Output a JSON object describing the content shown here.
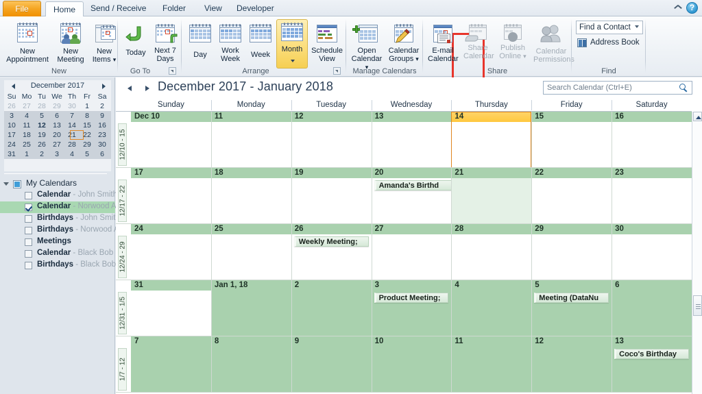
{
  "window": {
    "tabs": [
      {
        "label": "File",
        "id": "file"
      },
      {
        "label": "Home",
        "id": "home"
      },
      {
        "label": "Send / Receive",
        "id": "send-receive"
      },
      {
        "label": "Folder",
        "id": "folder"
      },
      {
        "label": "View",
        "id": "view"
      },
      {
        "label": "Developer",
        "id": "developer"
      }
    ],
    "active_tab": "Home",
    "help_label": "?",
    "minimize_ribbon_icon": "chevron-up-icon"
  },
  "ribbon": {
    "groups": [
      {
        "name": "New",
        "label": "New",
        "buttons": [
          {
            "label": "New\nAppointment",
            "id": "new-appointment",
            "icon": "calendar-icon",
            "enabled": true
          },
          {
            "label": "New\nMeeting",
            "id": "new-meeting",
            "icon": "calendar-people-icon",
            "enabled": true
          },
          {
            "label": "New\nItems",
            "id": "new-items",
            "icon": "calendar-stack-icon",
            "enabled": true,
            "has_caret": true
          }
        ]
      },
      {
        "name": "Go To",
        "label": "Go To",
        "has_dialog_launcher": true,
        "buttons": [
          {
            "label": "Today",
            "id": "today",
            "icon": "arrow-back-icon",
            "enabled": true
          },
          {
            "label": "Next 7\nDays",
            "id": "next-7-days",
            "icon": "calendar-arrow-icon",
            "enabled": true
          }
        ]
      },
      {
        "name": "Arrange",
        "label": "Arrange",
        "has_dialog_launcher": true,
        "buttons": [
          {
            "label": "Day",
            "id": "day-view",
            "icon": "calendar-day-icon",
            "enabled": true
          },
          {
            "label": "Work\nWeek",
            "id": "work-week-view",
            "icon": "calendar-workweek-icon",
            "enabled": true
          },
          {
            "label": "Week",
            "id": "week-view",
            "icon": "calendar-week-icon",
            "enabled": true
          },
          {
            "label": "Month",
            "id": "month-view",
            "icon": "calendar-month-icon",
            "enabled": true,
            "selected": true,
            "has_caret": true,
            "highlighted": true
          },
          {
            "label": "Schedule\nView",
            "id": "schedule-view",
            "icon": "schedule-icon",
            "enabled": true
          }
        ]
      },
      {
        "name": "Manage Calendars",
        "label": "Manage Calendars",
        "buttons": [
          {
            "label": "Open\nCalendar",
            "id": "open-calendar",
            "icon": "calendar-plus-icon",
            "enabled": true,
            "has_caret": true
          },
          {
            "label": "Calendar\nGroups",
            "id": "calendar-groups",
            "icon": "calendar-pencil-icon",
            "enabled": true,
            "has_caret": true
          }
        ]
      },
      {
        "name": "Share",
        "label": "Share",
        "buttons": [
          {
            "label": "E-mail\nCalendar",
            "id": "email-calendar",
            "icon": "calendar-mail-icon",
            "enabled": true
          },
          {
            "label": "Share\nCalendar",
            "id": "share-calendar",
            "icon": "calendar-hand-icon",
            "enabled": false
          },
          {
            "label": "Publish\nOnline",
            "id": "publish-online",
            "icon": "calendar-globe-icon",
            "enabled": false,
            "has_caret": true
          },
          {
            "label": "Calendar\nPermissions",
            "id": "calendar-permissions",
            "icon": "people-icon",
            "enabled": false
          }
        ]
      },
      {
        "name": "Find",
        "label": "Find",
        "find_a_contact": "Find a Contact",
        "address_book": "Address Book"
      }
    ]
  },
  "navpane": {
    "minicalendar": {
      "title": "December 2017",
      "prev_icon": "left-arrow-icon",
      "next_icon": "right-arrow-icon",
      "dow": [
        "Su",
        "Mo",
        "Tu",
        "We",
        "Th",
        "Fr",
        "Sa"
      ],
      "weeks": [
        [
          {
            "d": "26",
            "dim": true
          },
          {
            "d": "27",
            "dim": true
          },
          {
            "d": "28",
            "dim": true
          },
          {
            "d": "29",
            "dim": true
          },
          {
            "d": "30",
            "dim": true
          },
          {
            "d": "1"
          },
          {
            "d": "2"
          }
        ],
        [
          {
            "d": "3"
          },
          {
            "d": "4"
          },
          {
            "d": "5"
          },
          {
            "d": "6"
          },
          {
            "d": "7"
          },
          {
            "d": "8"
          },
          {
            "d": "9"
          }
        ],
        [
          {
            "d": "10"
          },
          {
            "d": "11"
          },
          {
            "d": "12",
            "bold": true
          },
          {
            "d": "13"
          },
          {
            "d": "14",
            "today": true
          },
          {
            "d": "15"
          },
          {
            "d": "16"
          }
        ],
        [
          {
            "d": "17"
          },
          {
            "d": "18"
          },
          {
            "d": "19"
          },
          {
            "d": "20"
          },
          {
            "d": "21"
          },
          {
            "d": "22"
          },
          {
            "d": "23"
          }
        ],
        [
          {
            "d": "24"
          },
          {
            "d": "25"
          },
          {
            "d": "26"
          },
          {
            "d": "27"
          },
          {
            "d": "28"
          },
          {
            "d": "29"
          },
          {
            "d": "30"
          }
        ],
        [
          {
            "d": "31"
          },
          {
            "d": "1"
          },
          {
            "d": "2"
          },
          {
            "d": "3"
          },
          {
            "d": "4"
          },
          {
            "d": "5"
          },
          {
            "d": "6"
          }
        ]
      ],
      "selected_range_rows": [
        2,
        3,
        4,
        5
      ],
      "today": "14"
    },
    "my_calendars_label": "My Calendars",
    "calendars": [
      {
        "name": "Calendar",
        "owner": " - John Smith",
        "checked": false
      },
      {
        "name": "Calendar",
        "owner": " - Norwood A",
        "checked": true
      },
      {
        "name": "Birthdays",
        "owner": " - John Smith",
        "checked": false
      },
      {
        "name": "Birthdays",
        "owner": " - Norwood A",
        "checked": false
      },
      {
        "name": "Meetings",
        "owner": "",
        "checked": false
      },
      {
        "name": "Calendar",
        "owner": " - Black Bob",
        "checked": false
      },
      {
        "name": "Birthdays",
        "owner": " - Black Bob",
        "checked": false
      }
    ]
  },
  "calendar": {
    "title": "December 2017 - January 2018",
    "prev_icon": "left-arrow-icon",
    "next_icon": "right-arrow-icon",
    "search_placeholder": "Search Calendar (Ctrl+E)",
    "search_icon": "search-icon",
    "day_headers": [
      "Sunday",
      "Monday",
      "Tuesday",
      "Wednesday",
      "Thursday",
      "Friday",
      "Saturday"
    ],
    "weeks": [
      {
        "label": "12/10 - 15",
        "days": [
          {
            "num": "Dec 10"
          },
          {
            "num": "11"
          },
          {
            "num": "12"
          },
          {
            "num": "13"
          },
          {
            "num": "14",
            "today": true
          },
          {
            "num": "15"
          },
          {
            "num": "16"
          }
        ]
      },
      {
        "label": "12/17 - 22",
        "days": [
          {
            "num": "17"
          },
          {
            "num": "18"
          },
          {
            "num": "19"
          },
          {
            "num": "20",
            "appointments": [
              {
                "title": "Amanda's Birthd",
                "span": 2
              }
            ]
          },
          {
            "num": "21",
            "selected": true
          },
          {
            "num": "22"
          },
          {
            "num": "23"
          }
        ]
      },
      {
        "label": "12/24 - 29",
        "days": [
          {
            "num": "24"
          },
          {
            "num": "25"
          },
          {
            "num": "26",
            "appointments": [
              {
                "title": "Weekly Meeting;",
                "span": 1
              }
            ]
          },
          {
            "num": "27"
          },
          {
            "num": "28"
          },
          {
            "num": "29"
          },
          {
            "num": "30"
          }
        ]
      },
      {
        "label": "12/31 - 1/5",
        "days": [
          {
            "num": "31"
          },
          {
            "num": "Jan 1, 18",
            "offmonth": true
          },
          {
            "num": "2",
            "offmonth": true
          },
          {
            "num": "3",
            "offmonth": true,
            "appointments": [
              {
                "title": "Product Meeting;",
                "span": 1
              }
            ]
          },
          {
            "num": "4",
            "offmonth": true
          },
          {
            "num": "5",
            "offmonth": true,
            "appointments": [
              {
                "title": "Meeting (DataNu",
                "span": 1
              }
            ]
          },
          {
            "num": "6",
            "offmonth": true
          }
        ]
      },
      {
        "label": "1/7 - 12",
        "days": [
          {
            "num": "7",
            "offmonth": true
          },
          {
            "num": "8",
            "offmonth": true
          },
          {
            "num": "9",
            "offmonth": true
          },
          {
            "num": "10",
            "offmonth": true
          },
          {
            "num": "11",
            "offmonth": true
          },
          {
            "num": "12",
            "offmonth": true
          },
          {
            "num": "13",
            "offmonth": true,
            "appointments": [
              {
                "title": "Coco's Birthday",
                "span": 1
              }
            ]
          }
        ]
      }
    ],
    "scrollbar": {
      "up_icon": "scroll-up-icon",
      "thumb": "scroll-thumb"
    }
  },
  "colors": {
    "accent_orange": "#f5a623",
    "calendar_green": "#a9d1ae",
    "today_yellow": "#ffc83f",
    "selected_day": "#e4f1e6",
    "highlight_red": "#e8352b",
    "appointment_bg": "#d6e9d8"
  }
}
